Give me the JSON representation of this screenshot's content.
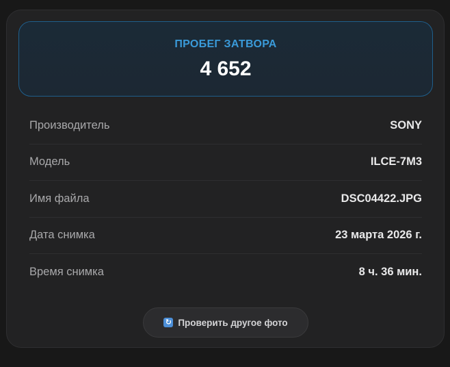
{
  "shutter": {
    "label": "ПРОБЕГ ЗАТВОРА",
    "value": "4 652"
  },
  "details": [
    {
      "label": "Производитель",
      "value": "SONY"
    },
    {
      "label": "Модель",
      "value": "ILCE-7M3"
    },
    {
      "label": "Имя файла",
      "value": "DSC04422.JPG"
    },
    {
      "label": "Дата снимка",
      "value": "23 марта 2026 г."
    },
    {
      "label": "Время снимка",
      "value": "8 ч. 36 мин."
    }
  ],
  "actions": {
    "check_another_label": "Проверить другое фото",
    "check_another_icon": "refresh-icon"
  },
  "colors": {
    "accent": "#3a9ad9",
    "hero_border": "#1f5f8c",
    "card_background": "#222223",
    "page_background": "#181818"
  }
}
